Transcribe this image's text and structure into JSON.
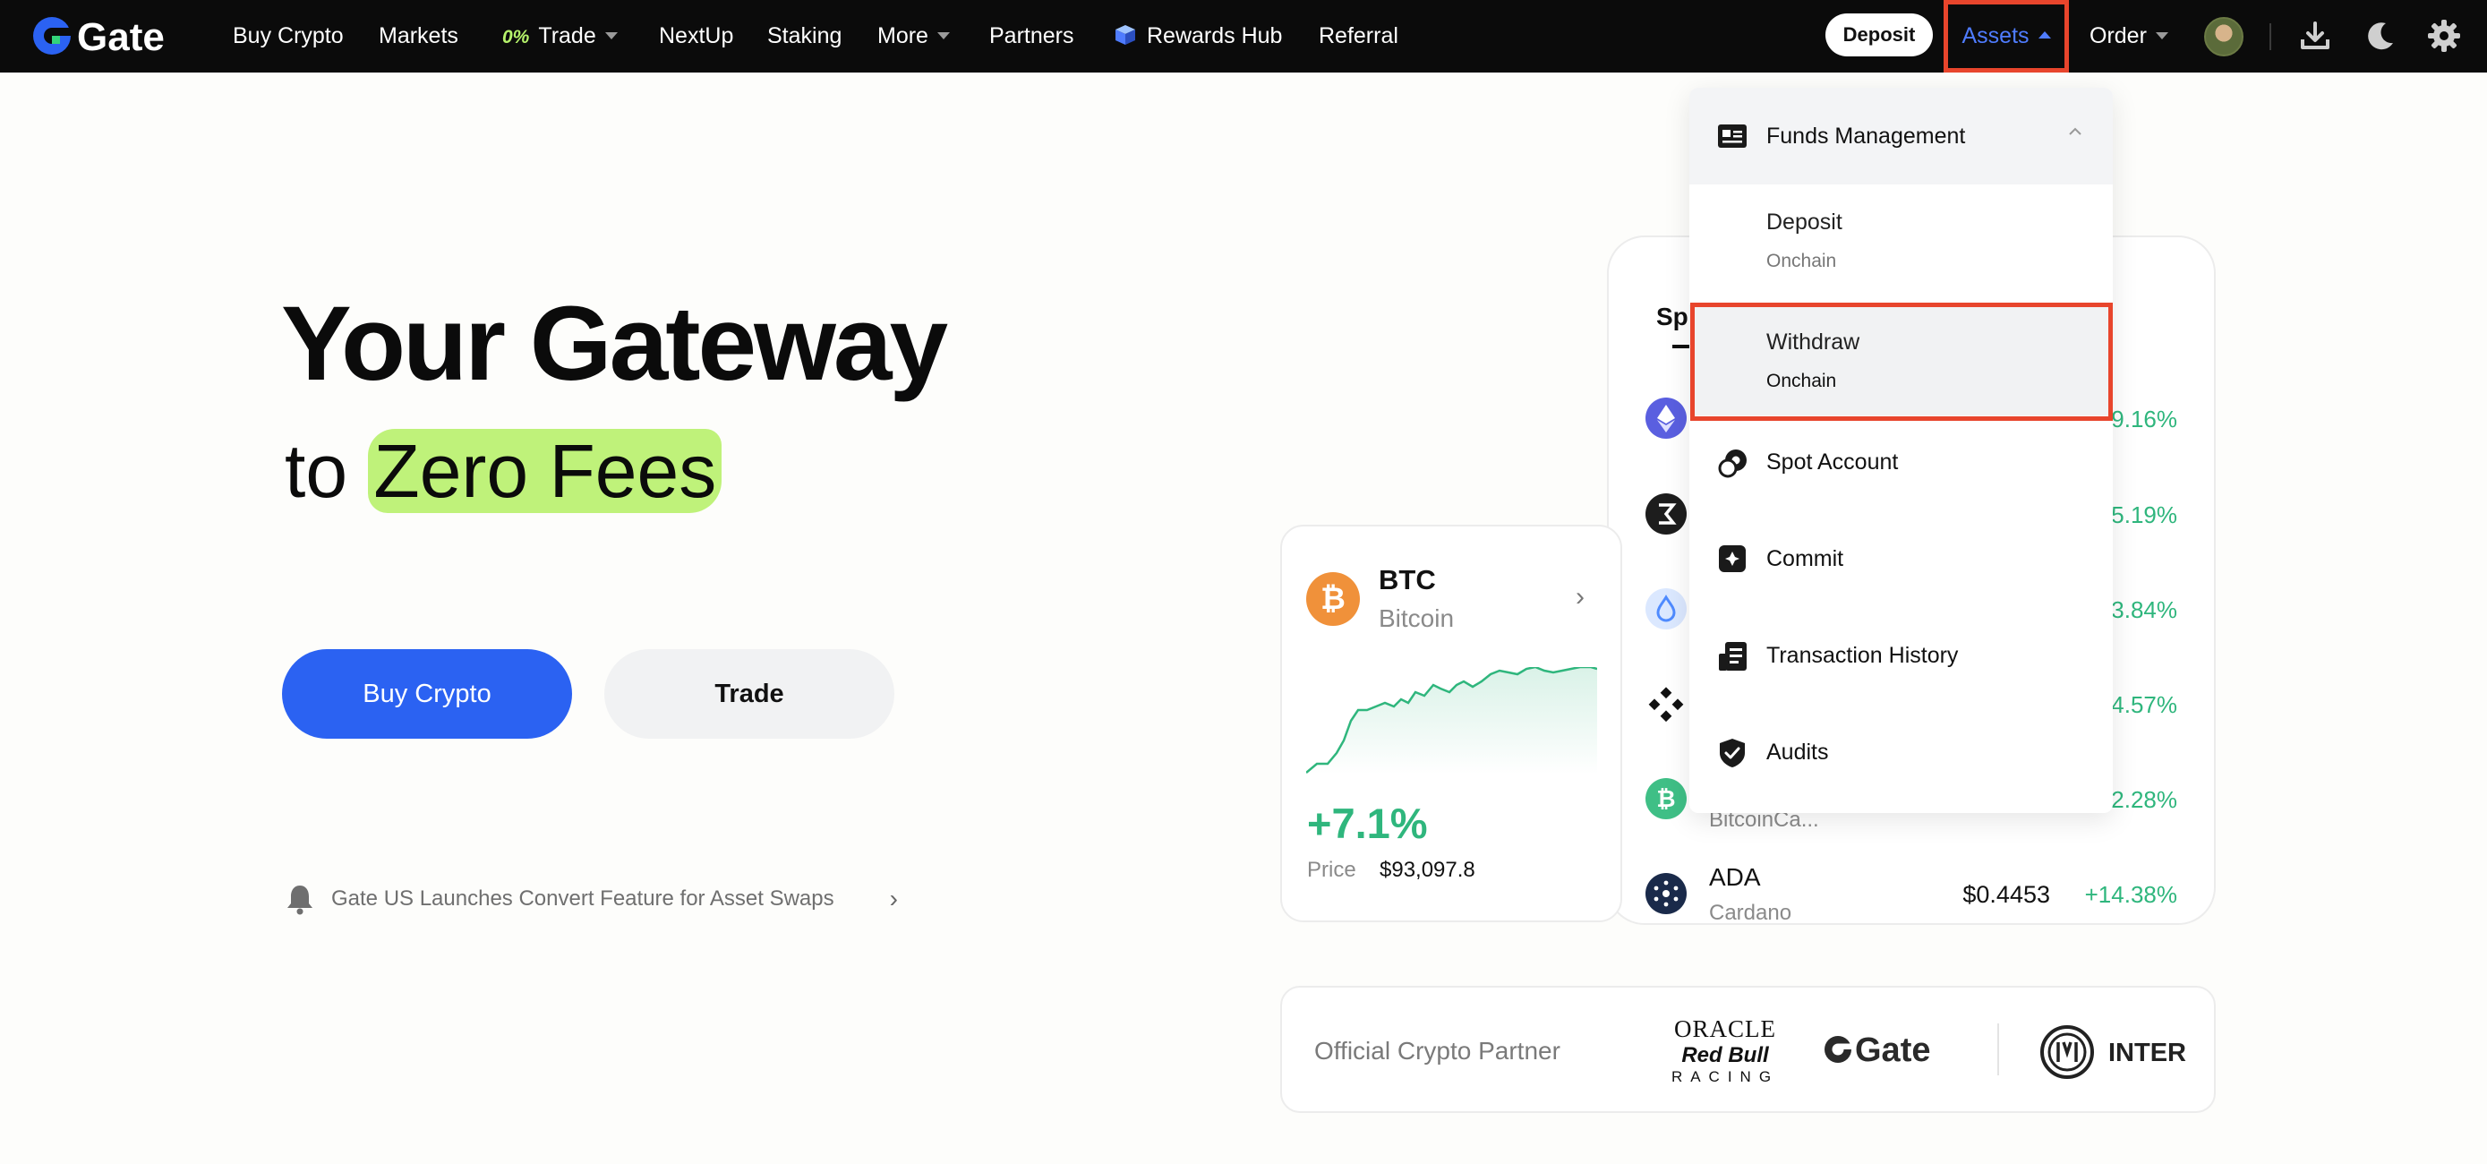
{
  "nav": {
    "logo_text": "Gate",
    "items": [
      {
        "label": "Buy Crypto"
      },
      {
        "label": "Markets"
      },
      {
        "label": "Trade",
        "badge": "0%"
      },
      {
        "label": "NextUp"
      },
      {
        "label": "Staking"
      },
      {
        "label": "More"
      },
      {
        "label": "Partners"
      },
      {
        "label": "Rewards Hub"
      },
      {
        "label": "Referral"
      }
    ],
    "deposit_label": "Deposit",
    "assets_label": "Assets",
    "order_label": "Order"
  },
  "hero": {
    "title": "Your Gateway",
    "sub_prefix": "to",
    "sub_highlight": "Zero Fees",
    "buy_label": "Buy Crypto",
    "trade_label": "Trade",
    "announcement": "Gate US Launches Convert Feature for Asset Swaps"
  },
  "market": {
    "tab_label": "Sp",
    "rows": [
      {
        "change": "9.16%",
        "color": "#5a5fe0"
      },
      {
        "change": "5.19%",
        "color": "#1d1d1d"
      },
      {
        "change": "3.84%",
        "color": "#dbe8ff"
      },
      {
        "change": "4.57%",
        "color": "#111111"
      },
      {
        "symbol_partial": "BitcoinCa...",
        "change": "2.28%",
        "color": "#3fbf86"
      },
      {
        "symbol": "ADA",
        "name": "Cardano",
        "price": "$0.4453",
        "change": "+14.38%",
        "color": "#1a2a4a"
      }
    ]
  },
  "btc_card": {
    "symbol": "BTC",
    "name": "Bitcoin",
    "change": "+7.1%",
    "price_label": "Price",
    "price": "$93,097.8"
  },
  "partner": {
    "label": "Official Crypto Partner",
    "oracle_line1": "ORACLE",
    "oracle_line2": "Red Bull",
    "oracle_line3": "RACING",
    "gate_text": "Gate",
    "inter_text": "INTER"
  },
  "dropdown": {
    "header": "Funds Management",
    "deposit": {
      "title": "Deposit",
      "sub": "Onchain"
    },
    "withdraw": {
      "title": "Withdraw",
      "sub": "Onchain"
    },
    "items": [
      {
        "label": "Spot Account",
        "icon": "spot-account-icon"
      },
      {
        "label": "Commit",
        "icon": "commit-icon"
      },
      {
        "label": "Transaction History",
        "icon": "transaction-history-icon"
      },
      {
        "label": "Audits",
        "icon": "audits-icon"
      }
    ]
  },
  "colors": {
    "brand_blue": "#2b62f2",
    "accent_green": "#2fb67d",
    "highlight_green": "#bff27a",
    "annotation_red": "#e8452c"
  }
}
